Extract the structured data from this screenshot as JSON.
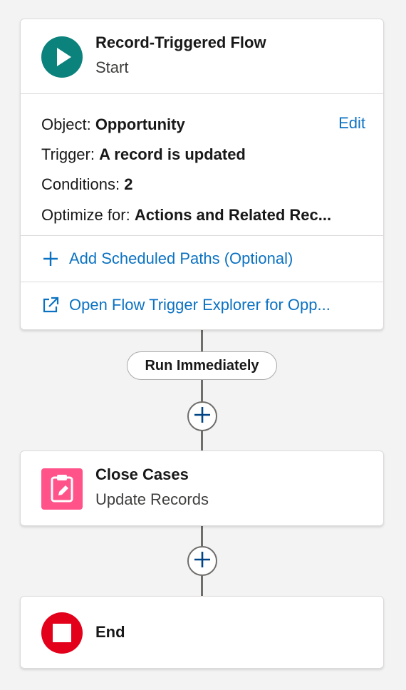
{
  "start_card": {
    "title": "Record-Triggered Flow",
    "subtitle": "Start",
    "icon": "play-icon",
    "icon_color": "#0b827c",
    "edit_label": "Edit",
    "details": [
      {
        "key": "Object: ",
        "value": "Opportunity"
      },
      {
        "key": "Trigger:  ",
        "value": "A record is updated"
      },
      {
        "key": "Conditions: ",
        "value": "2"
      },
      {
        "key": "Optimize for: ",
        "value": "Actions and Related Rec..."
      }
    ],
    "add_scheduled_paths_label": "Add Scheduled Paths (Optional)",
    "open_explorer_label": "Open Flow Trigger Explorer for Opp..."
  },
  "path_label": "Run Immediately",
  "update_card": {
    "title": "Close Cases",
    "subtitle": "Update Records",
    "icon": "clipboard-edit-icon",
    "icon_color": "#ff538a"
  },
  "end_card": {
    "title": "End",
    "icon": "stop-icon",
    "icon_color": "#e3001b"
  },
  "colors": {
    "link": "#0b72c2",
    "connector": "#706e6b",
    "add_icon": "#014486"
  }
}
